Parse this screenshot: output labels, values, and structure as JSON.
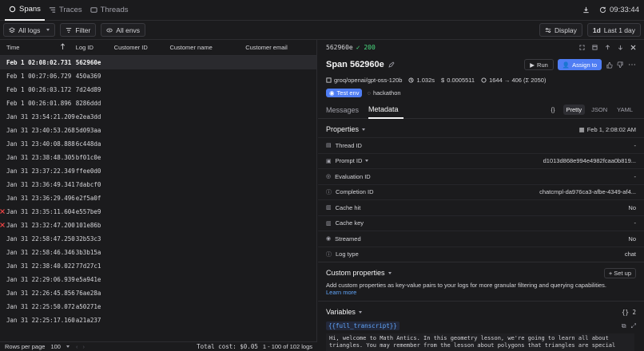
{
  "topbar": {
    "tabs": [
      {
        "label": "Spans",
        "icon": "spans-icon",
        "active": true
      },
      {
        "label": "Traces",
        "icon": "traces-icon",
        "active": false
      },
      {
        "label": "Threads",
        "icon": "threads-icon",
        "active": false
      }
    ],
    "clock": "09:33:44"
  },
  "filters": {
    "all_logs": "All logs",
    "filter": "Filter",
    "all_envs": "All envs",
    "display": "Display",
    "range_badge": "1d",
    "range": "Last 1 day"
  },
  "table": {
    "columns": [
      "Time",
      "Log ID",
      "Customer ID",
      "Customer name",
      "Customer email"
    ],
    "rows": [
      {
        "time": "Feb 1 02:08:02.731",
        "id": "562960e",
        "selected": true,
        "error": false
      },
      {
        "time": "Feb 1 00:27:06.729",
        "id": "450a369",
        "selected": false,
        "error": false
      },
      {
        "time": "Feb 1 00:26:03.172",
        "id": "7d24d89",
        "selected": false,
        "error": false
      },
      {
        "time": "Feb 1 00:26:01.896",
        "id": "8286ddd",
        "selected": false,
        "error": false
      },
      {
        "time": "Jan 31 23:54:21.209",
        "id": "e2ea3dd",
        "selected": false,
        "error": false
      },
      {
        "time": "Jan 31 23:40:53.268",
        "id": "5d093aa",
        "selected": false,
        "error": false
      },
      {
        "time": "Jan 31 23:40:08.888",
        "id": "6c448da",
        "selected": false,
        "error": false
      },
      {
        "time": "Jan 31 23:38:48.305",
        "id": "bf01c0e",
        "selected": false,
        "error": false
      },
      {
        "time": "Jan 31 23:37:22.349",
        "id": "ffee0d0",
        "selected": false,
        "error": false
      },
      {
        "time": "Jan 31 23:36:49.341",
        "id": "7dabcf0",
        "selected": false,
        "error": false
      },
      {
        "time": "Jan 31 23:36:29.496",
        "id": "e2f5a0f",
        "selected": false,
        "error": false
      },
      {
        "time": "Jan 31 23:35:11.604",
        "id": "e557be9",
        "selected": false,
        "error": true
      },
      {
        "time": "Jan 31 23:32:47.200",
        "id": "101e86b",
        "selected": false,
        "error": true
      },
      {
        "time": "Jan 31 22:58:47.250",
        "id": "32b53c3",
        "selected": false,
        "error": false
      },
      {
        "time": "Jan 31 22:58:46.346",
        "id": "3b3b15a",
        "selected": false,
        "error": false
      },
      {
        "time": "Jan 31 22:38:40.022",
        "id": "77d27c1",
        "selected": false,
        "error": false
      },
      {
        "time": "Jan 31 22:29:06.939",
        "id": "e5a941e",
        "selected": false,
        "error": false
      },
      {
        "time": "Jan 31 22:26:45.856",
        "id": "76ae28a",
        "selected": false,
        "error": false
      },
      {
        "time": "Jan 31 22:25:50.072",
        "id": "a50271e",
        "selected": false,
        "error": false
      },
      {
        "time": "Jan 31 22:25:17.160",
        "id": "a21a237",
        "selected": false,
        "error": false
      }
    ]
  },
  "footer": {
    "rows_per_page_label": "Rows per page",
    "rows_per_page": "100",
    "total_cost": "Total cost: $0.05",
    "range": "1 - 100 of 102 logs"
  },
  "detail": {
    "short_id": "562960e",
    "status": "200",
    "title": "Span 562960e",
    "run": "Run",
    "assign": "Assign to",
    "model": "groq/openai/gpt-oss-120b",
    "duration": "1.032s",
    "cost": "0.0005511",
    "tokens": "1644 → 406 (Σ 2050)",
    "tag_env": "Test env",
    "tag_other": "hackathon",
    "tabs": [
      "Messages",
      "Metadata"
    ],
    "formats": [
      "Pretty",
      "JSON",
      "YAML"
    ],
    "properties_title": "Properties",
    "properties_date": "Feb 1, 2:08:02 AM",
    "properties": [
      {
        "label": "Thread ID",
        "value": "-",
        "icon": "thread-icon"
      },
      {
        "label": "Prompt ID",
        "value": "d1013d868e994e4982fcaa0b819...",
        "icon": "prompt-icon"
      },
      {
        "label": "Evaluation ID",
        "value": "-",
        "icon": "evaluation-icon"
      },
      {
        "label": "Completion ID",
        "value": "chatcmpl-da976ca3-afbe-4349-af4...",
        "icon": "info-icon"
      },
      {
        "label": "Cache hit",
        "value": "No",
        "icon": "cache-icon"
      },
      {
        "label": "Cache key",
        "value": "-",
        "icon": "cache-icon"
      },
      {
        "label": "Streamed",
        "value": "No",
        "icon": "streamed-icon"
      },
      {
        "label": "Log type",
        "value": "chat",
        "icon": "info-icon"
      }
    ],
    "custom_title": "Custom properties",
    "custom_setup": "+ Set up",
    "custom_desc": "Add custom properties as key-value pairs to your logs for more granular filtering and querying capabilities.",
    "custom_more": "Learn more",
    "variables_title": "Variables",
    "variables_count": "{} 2",
    "variable_name": "{{full_transcript}}",
    "variable_text": "Hi, welcome to Math Antics. In this geometry lesson, we're going to learn all about triangles. You may remember from the lesson about polygons that triangles are special"
  },
  "colors": {
    "accent": "#4f7df3",
    "success": "#4ade80",
    "error": "#ef4444",
    "background": "#1b1b1d"
  }
}
